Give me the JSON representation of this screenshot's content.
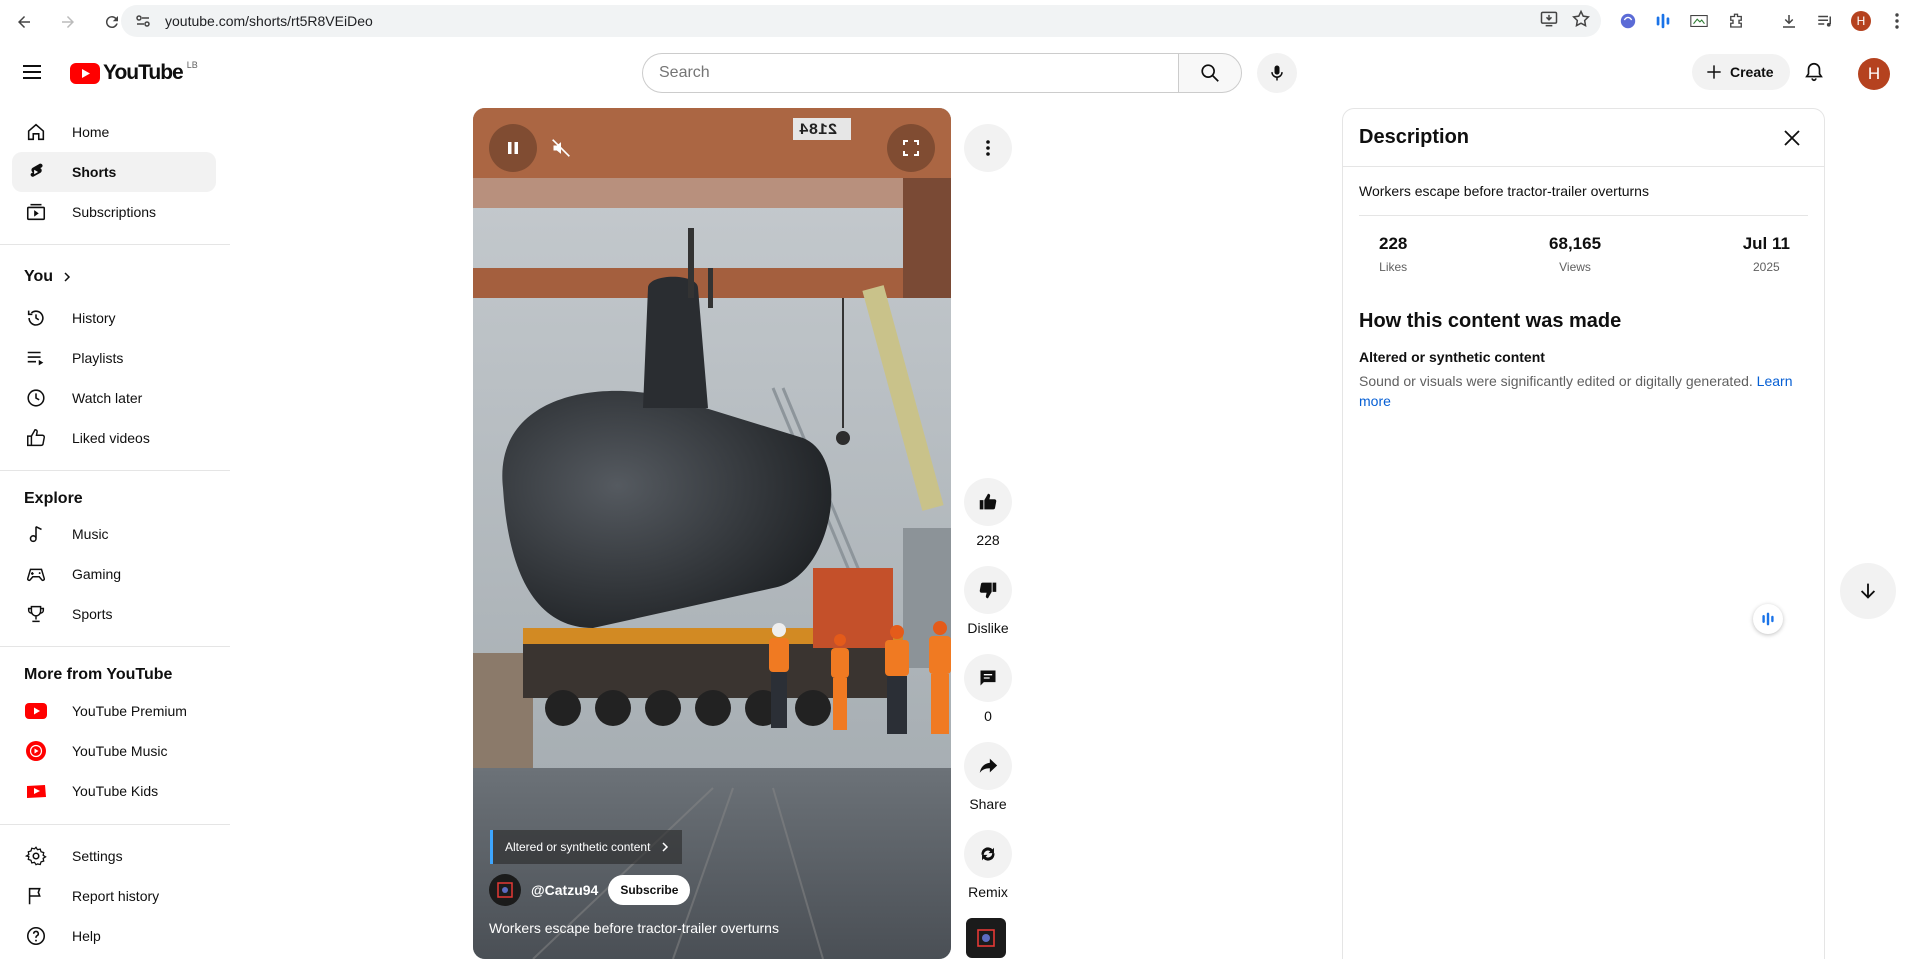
{
  "browser": {
    "url": "youtube.com/shorts/rt5R8VEiDeo",
    "profile_initial": "H"
  },
  "header": {
    "region": "LB",
    "search_placeholder": "Search",
    "create_label": "Create",
    "avatar_initial": "H"
  },
  "sidebar": {
    "main": [
      {
        "label": "Home",
        "icon": "home-icon"
      },
      {
        "label": "Shorts",
        "icon": "shorts-icon",
        "active": true
      },
      {
        "label": "Subscriptions",
        "icon": "subscriptions-icon"
      }
    ],
    "you_heading": "You",
    "you": [
      {
        "label": "History",
        "icon": "history-icon"
      },
      {
        "label": "Playlists",
        "icon": "playlists-icon"
      },
      {
        "label": "Watch later",
        "icon": "watch-later-icon"
      },
      {
        "label": "Liked videos",
        "icon": "like-icon"
      }
    ],
    "explore_heading": "Explore",
    "explore": [
      {
        "label": "Music",
        "icon": "music-icon"
      },
      {
        "label": "Gaming",
        "icon": "gaming-icon"
      },
      {
        "label": "Sports",
        "icon": "trophy-icon"
      }
    ],
    "more_heading": "More from YouTube",
    "more": [
      {
        "label": "YouTube Premium",
        "icon": "youtube-premium-icon"
      },
      {
        "label": "YouTube Music",
        "icon": "youtube-music-icon"
      },
      {
        "label": "YouTube Kids",
        "icon": "youtube-kids-icon"
      }
    ],
    "bottom": [
      {
        "label": "Settings",
        "icon": "gear-icon"
      },
      {
        "label": "Report history",
        "icon": "flag-icon"
      },
      {
        "label": "Help",
        "icon": "help-icon"
      }
    ]
  },
  "video": {
    "altered_chip": "Altered or synthetic content",
    "channel": "@Catzu94",
    "subscribe_label": "Subscribe",
    "title": "Workers escape before tractor-trailer overturns",
    "crane_number": "2184"
  },
  "actions": {
    "likes": "228",
    "dislike_label": "Dislike",
    "comments": "0",
    "share_label": "Share",
    "remix_label": "Remix"
  },
  "description": {
    "heading": "Description",
    "text": "Workers escape before tractor-trailer overturns",
    "stats": [
      {
        "value": "228",
        "label": "Likes"
      },
      {
        "value": "68,165",
        "label": "Views"
      },
      {
        "value": "Jul 11",
        "label": "2025"
      }
    ],
    "how_heading": "How this content was made",
    "altered_title": "Altered or synthetic content",
    "altered_desc": "Sound or visuals were significantly edited or digitally generated.",
    "learn_more": "Learn more"
  },
  "colors": {
    "brand_red": "#ff0000",
    "link_blue": "#065fd4",
    "avatar": "#b5421f"
  }
}
